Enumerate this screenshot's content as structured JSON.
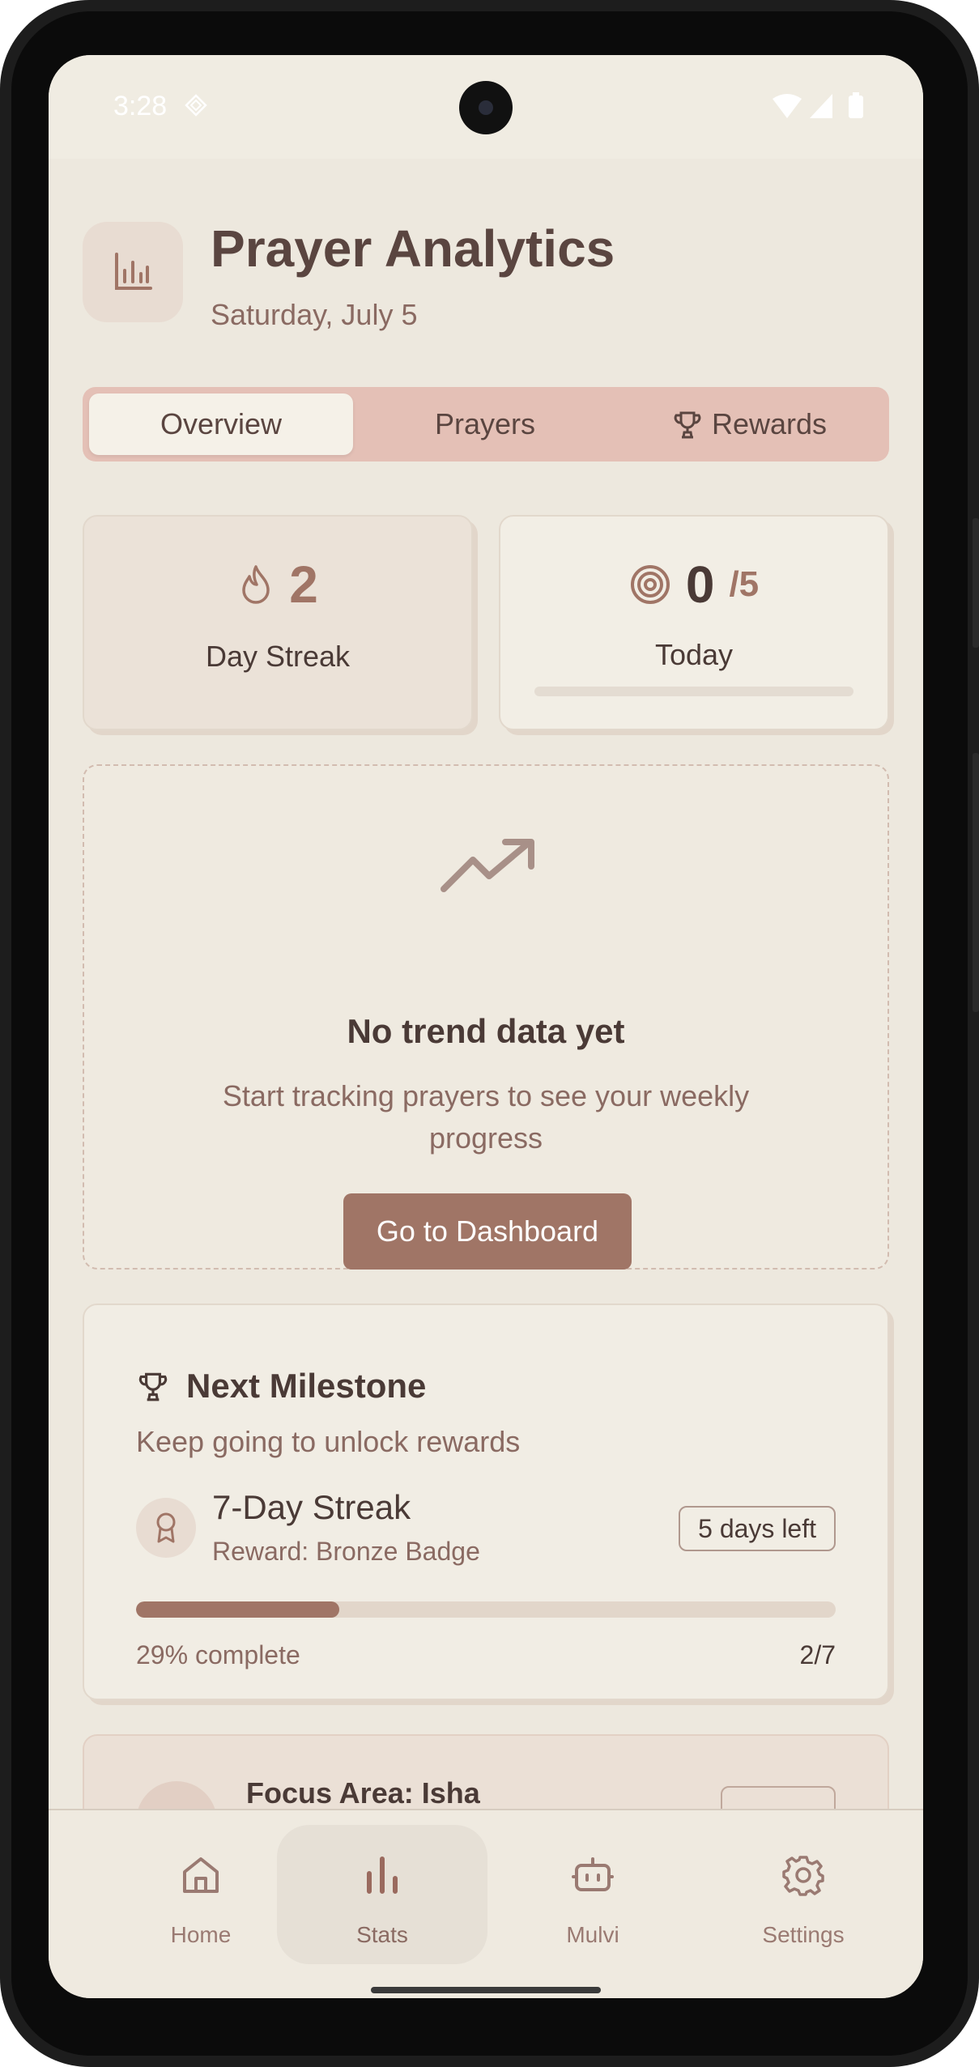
{
  "status_bar": {
    "time": "3:28"
  },
  "header": {
    "title": "Prayer Analytics",
    "date": "Saturday, July 5"
  },
  "tabs": [
    {
      "label": "Overview",
      "active": true
    },
    {
      "label": "Prayers",
      "active": false
    },
    {
      "label": "Rewards",
      "active": false,
      "icon": "trophy-icon"
    }
  ],
  "stats": {
    "streak": {
      "value": "2",
      "label": "Day Streak",
      "icon": "flame-icon"
    },
    "today": {
      "value": "0",
      "total": "/5",
      "label": "Today",
      "icon": "target-icon",
      "progress": 0
    }
  },
  "trend": {
    "icon": "trending-up-icon",
    "title": "No trend data yet",
    "subtitle": "Start tracking prayers to see your weekly progress",
    "button": "Go to Dashboard"
  },
  "milestone": {
    "title": "Next Milestone",
    "subtitle": "Keep going to unlock rewards",
    "name": "7-Day Streak",
    "reward": "Reward: Bronze Badge",
    "days_left": "5 days left",
    "progress_percent": 29,
    "percent_label": "29% complete",
    "count": "2/7"
  },
  "focus": {
    "title": "Focus Area: Isha"
  },
  "nav": [
    {
      "label": "Home",
      "icon": "home-icon",
      "active": false
    },
    {
      "label": "Stats",
      "icon": "bar-chart-icon",
      "active": true
    },
    {
      "label": "Mulvi",
      "icon": "robot-icon",
      "active": false
    },
    {
      "label": "Settings",
      "icon": "gear-icon",
      "active": false
    }
  ],
  "colors": {
    "accent": "#a07566",
    "background": "#ede8de",
    "tab_bar": "#e4c0b6",
    "text_dark": "#4a3a36",
    "text_muted": "#8a6a62"
  }
}
